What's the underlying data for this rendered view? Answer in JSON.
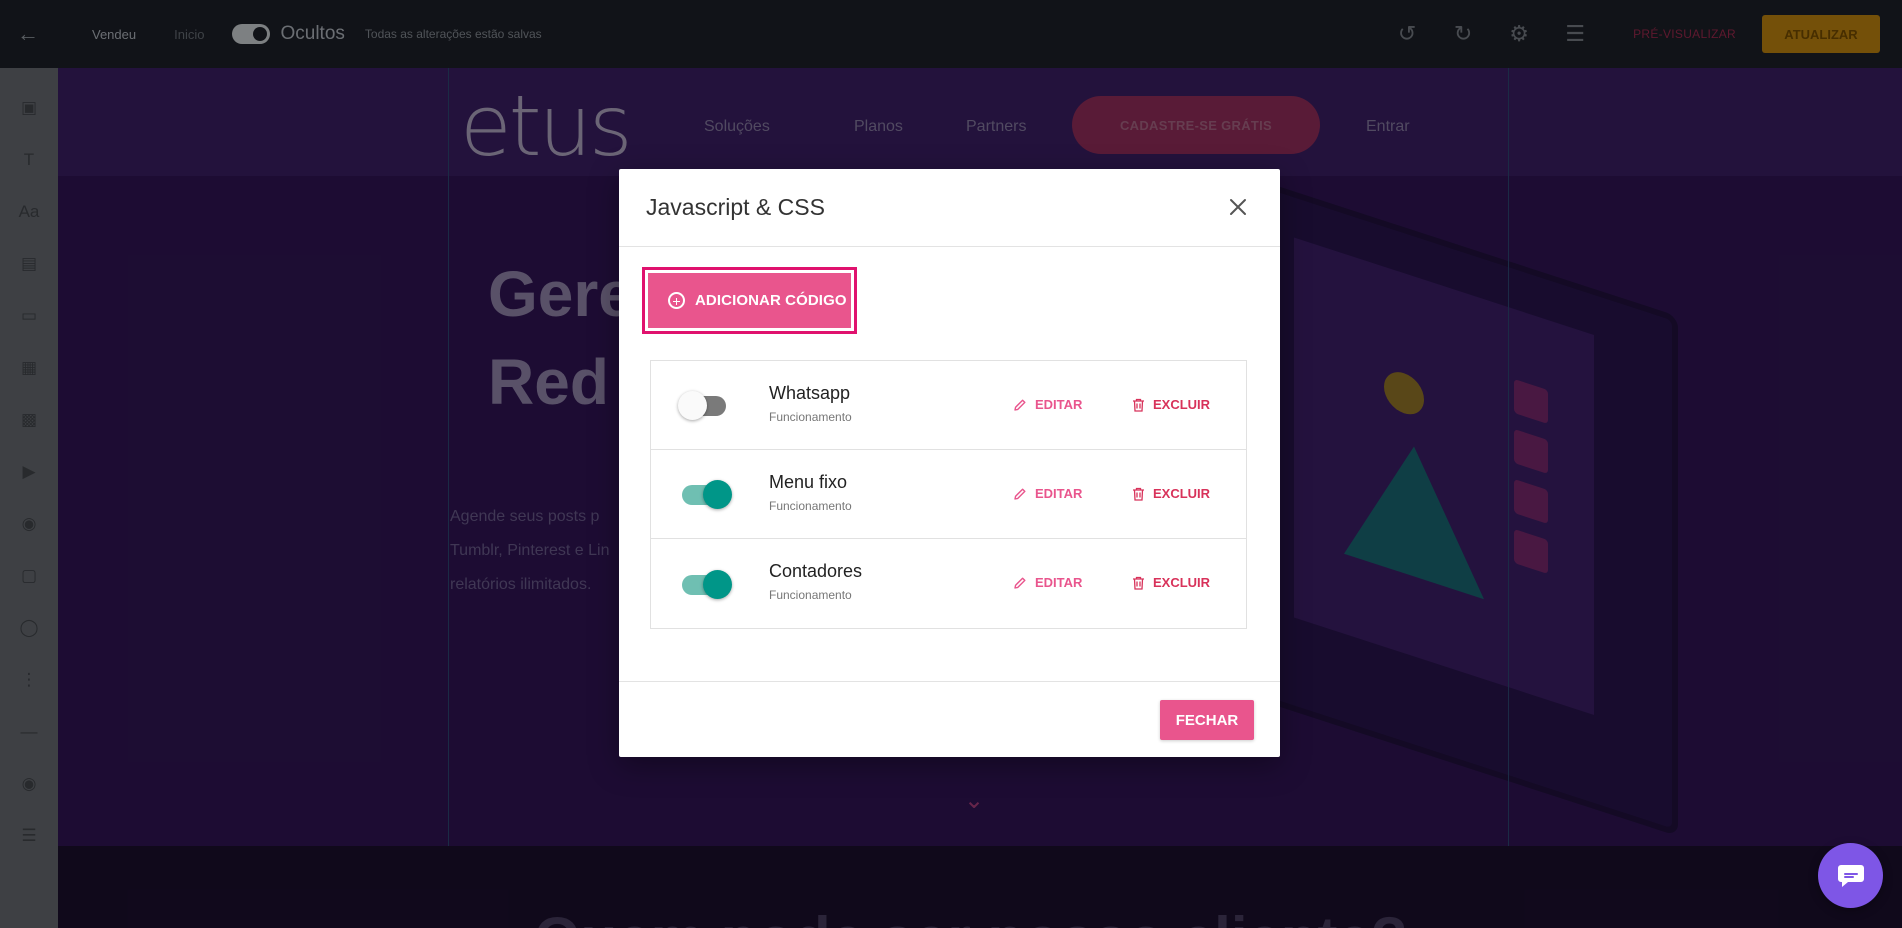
{
  "topbar": {
    "page_name": "Vendeu",
    "draft_label": "Inicio",
    "status_text": "Ocultos",
    "note": "Todas as alterações estão salvas",
    "preview_label": "PRÉ-VISUALIZAR",
    "publish_label": "ATUALIZAR"
  },
  "site": {
    "logo_text": "etus",
    "nav": [
      "Soluções",
      "Planos",
      "Partners",
      "Entrar"
    ],
    "nav_cta": "CADASTRE-SE GRÁTIS",
    "hero_line1": "Gere",
    "hero_line2": "Red",
    "hero_text1": "Agende seus posts p",
    "hero_text2": "Tumblr, Pinterest e Lin",
    "hero_text3": "relatórios ilimitados.",
    "band_title": "Quem pode ser nosso cliente?"
  },
  "modal": {
    "title": "Javascript & CSS",
    "add_button_label": "ADICIONAR CÓDIGO",
    "close_button_label": "FECHAR",
    "edit_label": "EDITAR",
    "delete_label": "EXCLUIR",
    "items": [
      {
        "name": "Whatsapp",
        "subtitle": "Funcionamento",
        "enabled": false
      },
      {
        "name": "Menu fixo",
        "subtitle": "Funcionamento",
        "enabled": true
      },
      {
        "name": "Contadores",
        "subtitle": "Funcionamento",
        "enabled": true
      }
    ]
  },
  "colors": {
    "accent": "#e9558d",
    "accent_border": "#e0126e",
    "toggle_on": "#009688",
    "delete": "#d8325a",
    "chat": "#7e56e6"
  },
  "icons": {
    "add": "plus-circle-icon",
    "edit": "pencil-icon",
    "delete": "trash-icon",
    "close": "close-icon",
    "chat": "chat-icon"
  }
}
